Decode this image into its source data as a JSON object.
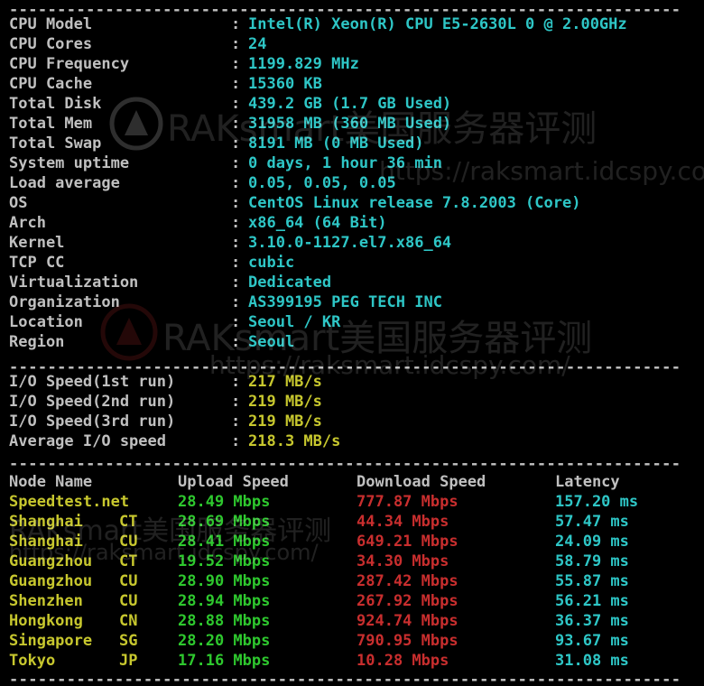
{
  "colors": {
    "background": "#000000",
    "label": "#c0c0c0",
    "cyan": "#2ec6c6",
    "yellow": "#c7c72e",
    "green": "#2ec82e",
    "red": "#c82e2e"
  },
  "system_info": [
    {
      "label": "CPU Model",
      "value": "Intel(R) Xeon(R) CPU E5-2630L 0 @ 2.00GHz"
    },
    {
      "label": "CPU Cores",
      "value": "24"
    },
    {
      "label": "CPU Frequency",
      "value": "1199.829 MHz"
    },
    {
      "label": "CPU Cache",
      "value": "15360 KB"
    },
    {
      "label": "Total Disk",
      "value": "439.2 GB (1.7 GB Used)"
    },
    {
      "label": "Total Mem",
      "value": "31958 MB (360 MB Used)"
    },
    {
      "label": "Total Swap",
      "value": "8191 MB (0 MB Used)"
    },
    {
      "label": "System uptime",
      "value": "0 days, 1 hour 36 min"
    },
    {
      "label": "Load average",
      "value": "0.05, 0.05, 0.05"
    },
    {
      "label": "OS",
      "value": "CentOS Linux release 7.8.2003 (Core)"
    },
    {
      "label": "Arch",
      "value": "x86_64 (64 Bit)"
    },
    {
      "label": "Kernel",
      "value": "3.10.0-1127.el7.x86_64"
    },
    {
      "label": "TCP CC",
      "value": "cubic"
    },
    {
      "label": "Virtualization",
      "value": "Dedicated"
    },
    {
      "label": "Organization",
      "value": "AS399195 PEG TECH INC"
    },
    {
      "label": "Location",
      "value": "Seoul / KR"
    },
    {
      "label": "Region",
      "value": "Seoul"
    }
  ],
  "colon": ":",
  "separator": "----------------------------------------------------------------------",
  "io_speed": [
    {
      "label": "I/O Speed(1st run)",
      "value": "217 MB/s"
    },
    {
      "label": "I/O Speed(2nd run)",
      "value": "219 MB/s"
    },
    {
      "label": "I/O Speed(3rd run)",
      "value": "219 MB/s"
    },
    {
      "label": "Average I/O speed",
      "value": "218.3 MB/s"
    }
  ],
  "speedtest": {
    "headers": {
      "node": "Node Name",
      "upload": "Upload Speed",
      "download": "Download Speed",
      "latency": "Latency"
    },
    "rows": [
      {
        "node": "Speedtest.net",
        "isp": "",
        "upload": "28.49 Mbps",
        "download": "777.87 Mbps",
        "latency": "157.20 ms"
      },
      {
        "node": "Shanghai",
        "isp": "CT",
        "upload": "28.69 Mbps",
        "download": "44.34 Mbps",
        "latency": "57.47 ms"
      },
      {
        "node": "Shanghai",
        "isp": "CU",
        "upload": "28.41 Mbps",
        "download": "649.21 Mbps",
        "latency": "24.09 ms"
      },
      {
        "node": "Guangzhou",
        "isp": "CT",
        "upload": "19.52 Mbps",
        "download": "34.30 Mbps",
        "latency": "58.79 ms"
      },
      {
        "node": "Guangzhou",
        "isp": "CU",
        "upload": "28.90 Mbps",
        "download": "287.42 Mbps",
        "latency": "55.87 ms"
      },
      {
        "node": "Shenzhen",
        "isp": "CU",
        "upload": "28.94 Mbps",
        "download": "267.92 Mbps",
        "latency": "56.21 ms"
      },
      {
        "node": "Hongkong",
        "isp": "CN",
        "upload": "28.88 Mbps",
        "download": "924.74 Mbps",
        "latency": "36.37 ms"
      },
      {
        "node": "Singapore",
        "isp": "SG",
        "upload": "28.20 Mbps",
        "download": "790.95 Mbps",
        "latency": "93.67 ms"
      },
      {
        "node": "Tokyo",
        "isp": "JP",
        "upload": "17.16 Mbps",
        "download": "10.28 Mbps",
        "latency": "31.08 ms"
      }
    ]
  },
  "watermark": {
    "brand": "RAKsmart美国服务器评测",
    "url": "https://raksmart.idcspy.com/"
  }
}
